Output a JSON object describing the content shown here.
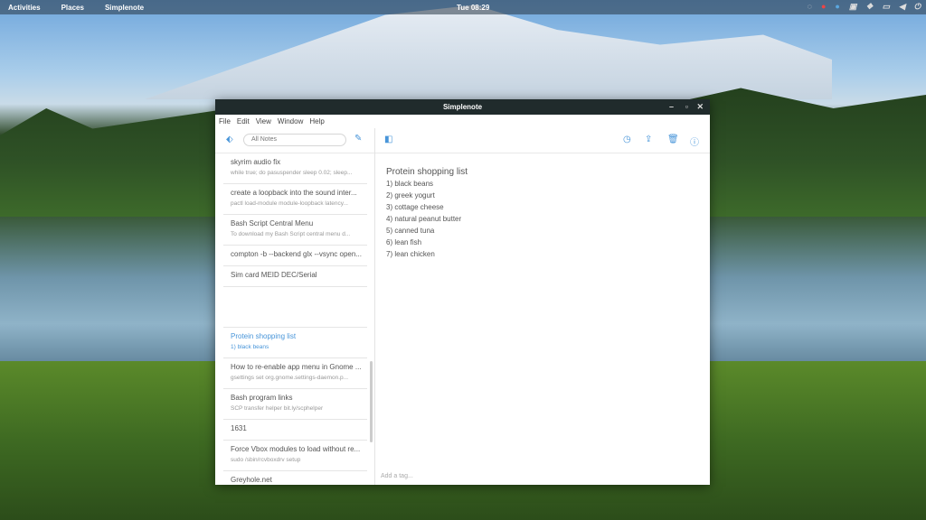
{
  "topbar": {
    "activities": "Activities",
    "places": "Places",
    "app": "Simplenote",
    "clock": "Tue 08:29"
  },
  "window": {
    "title": "Simplenote"
  },
  "menu": [
    "File",
    "Edit",
    "View",
    "Window",
    "Help"
  ],
  "search": {
    "placeholder": "All Notes"
  },
  "notes": [
    {
      "title": "skyrim audio fix",
      "preview": "while true; do pasuspender sleep 0.02; sleep..."
    },
    {
      "title": "create a loopback into the sound inter...",
      "preview": "pactl load-module module-loopback latency..."
    },
    {
      "title": "Bash Script Central Menu",
      "preview": "To download my Bash Script central menu d..."
    },
    {
      "title": "compton -b --backend glx --vsync open..."
    },
    {
      "title": "Sim card MEID DEC/Serial"
    },
    {
      "title": ""
    },
    {
      "title": "Protein shopping list",
      "preview": "1) black beans",
      "selected": true
    },
    {
      "title": "How to re-enable app menu in Gnome ...",
      "preview": "gsettings set org.gnome.settings-daemon.p..."
    },
    {
      "title": "Bash program links",
      "preview": "SCP transfer helper bit.ly/scphelper"
    },
    {
      "title": "1631"
    },
    {
      "title": "Force Vbox modules to load without re...",
      "preview": "sudo /sbin/rcvboxdrv setup"
    },
    {
      "title": "Greyhole.net"
    }
  ],
  "editor": {
    "title": "Protein shopping list",
    "lines": [
      "1) black beans",
      "2) greek yogurt",
      "3) cottage cheese",
      "4) natural peanut butter",
      "5) canned tuna",
      "6) lean fish",
      "7) lean chicken"
    ],
    "tag_placeholder": "Add a tag..."
  }
}
